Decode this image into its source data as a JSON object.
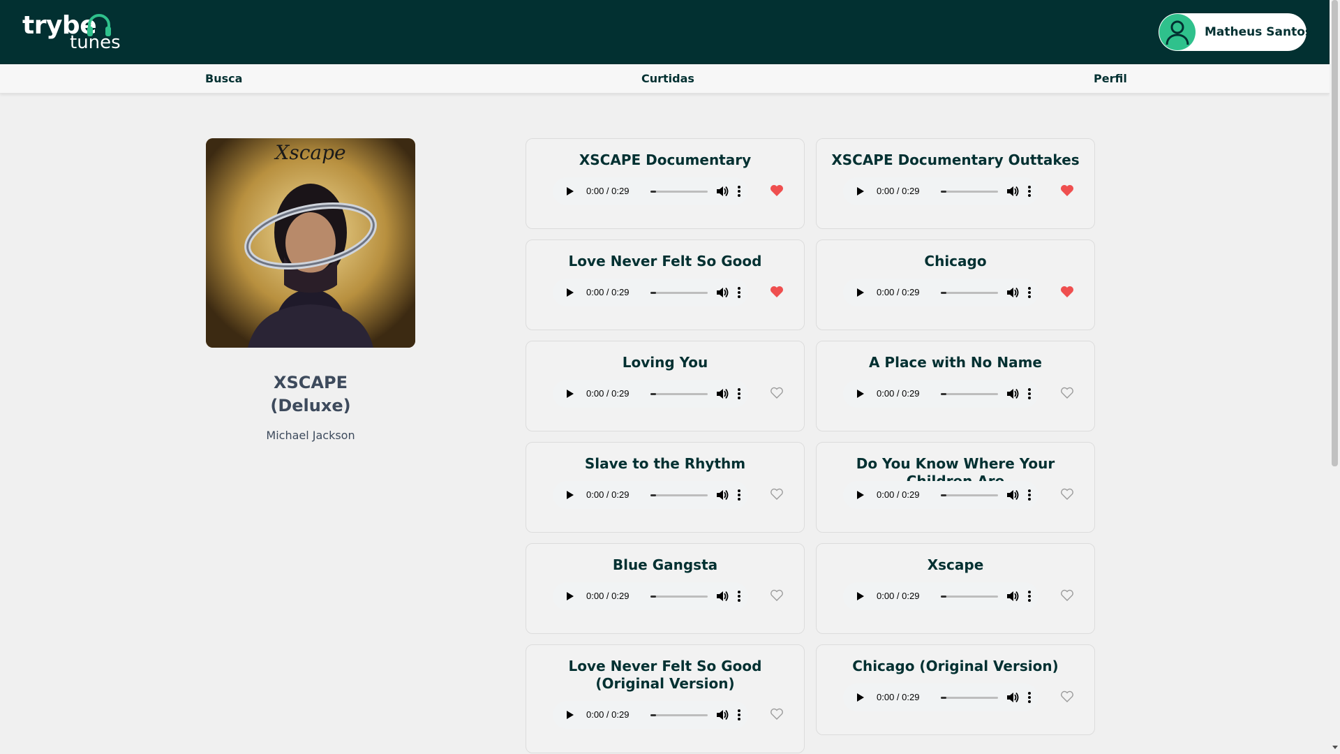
{
  "header": {
    "logo_word_1": "trybe",
    "logo_word_2": "tunes",
    "user_name": "Matheus Santos",
    "colors": {
      "bg": "#023031",
      "accent": "#2fc18c"
    }
  },
  "nav": {
    "items": [
      {
        "label": "Busca"
      },
      {
        "label": "Curtidas"
      },
      {
        "label": "Perfil"
      }
    ]
  },
  "album": {
    "cover_title_script": "Xscape",
    "title_line_1": "XSCAPE",
    "title_line_2": "(Deluxe)",
    "artist": "Michael Jackson"
  },
  "player_defaults": {
    "time": "0:00 / 0:29"
  },
  "tracks": [
    {
      "name": "XSCAPE Documentary",
      "favorite": true
    },
    {
      "name": "XSCAPE Documentary Outtakes",
      "favorite": true
    },
    {
      "name": "Love Never Felt So Good",
      "favorite": true
    },
    {
      "name": "Chicago",
      "favorite": true
    },
    {
      "name": "Loving You",
      "favorite": false
    },
    {
      "name": "A Place with No Name",
      "favorite": false
    },
    {
      "name": "Slave to the Rhythm",
      "favorite": false
    },
    {
      "name": "Do You Know Where Your Children Are",
      "favorite": false
    },
    {
      "name": "Blue Gangsta",
      "favorite": false
    },
    {
      "name": "Xscape",
      "favorite": false
    },
    {
      "name": "Love Never Felt So Good (Original Version)",
      "favorite": false
    },
    {
      "name": "Chicago (Original Version)",
      "favorite": false
    }
  ],
  "colors": {
    "heart_filled": "#ef4f4f",
    "heart_outline": "#9a9a9a"
  }
}
